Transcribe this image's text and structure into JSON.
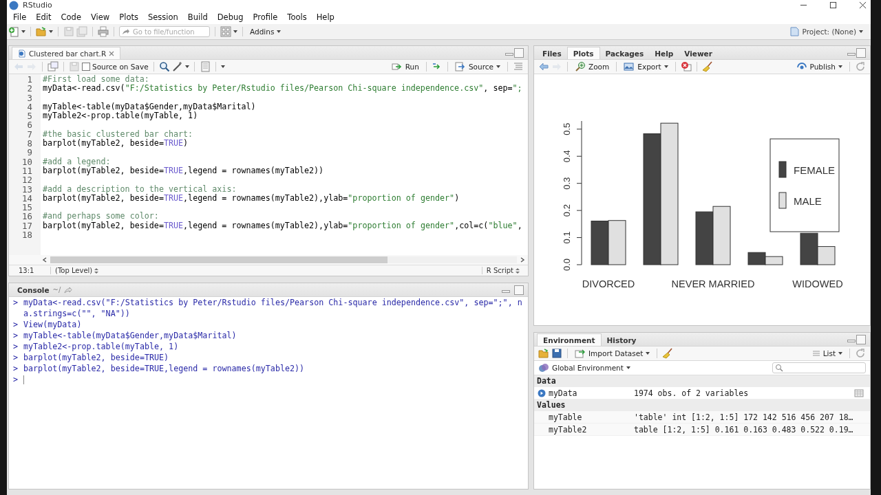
{
  "window": {
    "title": "RStudio"
  },
  "menu": [
    "File",
    "Edit",
    "Code",
    "View",
    "Plots",
    "Session",
    "Build",
    "Debug",
    "Profile",
    "Tools",
    "Help"
  ],
  "toolbar": {
    "goto_placeholder": "Go to file/function",
    "addins": "Addins",
    "project": "Project: (None)"
  },
  "editor": {
    "tab": {
      "label": "Clustered bar chart.R",
      "selected": true
    },
    "source_on_save": {
      "label": "Source on Save",
      "checked": false
    },
    "run": "Run",
    "source": "Source",
    "lines": [
      {
        "number": "1",
        "tokens": [
          {
            "kind": "comment",
            "text": "#First load some data:"
          }
        ]
      },
      {
        "number": "2",
        "tokens": [
          {
            "kind": "code",
            "text": "myData<-read.csv("
          },
          {
            "kind": "string",
            "text": "\"F:/Statistics by Peter/Rstudio files/Pearson Chi-square independence.csv\""
          },
          {
            "kind": "code",
            "text": ", sep="
          },
          {
            "kind": "string",
            "text": "\";"
          }
        ]
      },
      {
        "number": "3"
      },
      {
        "number": "4",
        "tokens": [
          {
            "kind": "code",
            "text": "myTable<-table(myData$Gender,myData$Marital)"
          }
        ]
      },
      {
        "number": "5",
        "tokens": [
          {
            "kind": "code",
            "text": "myTable2<-prop.table(myTable, 1)"
          }
        ]
      },
      {
        "number": "6"
      },
      {
        "number": "7",
        "tokens": [
          {
            "kind": "comment",
            "text": "#the basic clustered bar chart:"
          }
        ]
      },
      {
        "number": "8",
        "tokens": [
          {
            "kind": "code",
            "text": "barplot(myTable2, beside="
          },
          {
            "kind": "keyword",
            "text": "TRUE"
          },
          {
            "kind": "code",
            "text": ")"
          }
        ]
      },
      {
        "number": "9"
      },
      {
        "number": "10",
        "tokens": [
          {
            "kind": "comment",
            "text": "#add a legend:"
          }
        ]
      },
      {
        "number": "11",
        "tokens": [
          {
            "kind": "code",
            "text": "barplot(myTable2, beside="
          },
          {
            "kind": "keyword",
            "text": "TRUE"
          },
          {
            "kind": "code",
            "text": ",legend = rownames(myTable2))"
          }
        ]
      },
      {
        "number": "12"
      },
      {
        "number": "13",
        "tokens": [
          {
            "kind": "comment",
            "text": "#add a description to the vertical axis:"
          }
        ]
      },
      {
        "number": "14",
        "tokens": [
          {
            "kind": "code",
            "text": "barplot(myTable2, beside="
          },
          {
            "kind": "keyword",
            "text": "TRUE"
          },
          {
            "kind": "code",
            "text": ",legend = rownames(myTable2),ylab="
          },
          {
            "kind": "string",
            "text": "\"proportion of gender\""
          },
          {
            "kind": "code",
            "text": ")"
          }
        ]
      },
      {
        "number": "15"
      },
      {
        "number": "16",
        "tokens": [
          {
            "kind": "comment",
            "text": "#and perhaps some color:"
          }
        ]
      },
      {
        "number": "17",
        "tokens": [
          {
            "kind": "code",
            "text": "barplot(myTable2, beside="
          },
          {
            "kind": "keyword",
            "text": "TRUE"
          },
          {
            "kind": "code",
            "text": ",legend = rownames(myTable2),ylab="
          },
          {
            "kind": "string",
            "text": "\"proportion of gender\""
          },
          {
            "kind": "code",
            "text": ",col=c("
          },
          {
            "kind": "string",
            "text": "\"blue\""
          },
          {
            "kind": "code",
            "text": ","
          }
        ]
      },
      {
        "number": "18"
      }
    ],
    "cursor": "13:1",
    "scope": "(Top Level)",
    "file_type": "R Script"
  },
  "console": {
    "title": "Console",
    "path": "~/",
    "lines": [
      {
        "prompt": ">",
        "text": "myData<-read.csv(\"F:/Statistics by Peter/Rstudio files/Pearson Chi-square independence.csv\", sep=\";\", n"
      },
      {
        "text": "a.strings=c(\"\", \"NA\"))"
      },
      {
        "prompt": ">",
        "text": "View(myData)"
      },
      {
        "prompt": ">",
        "text": "myTable<-table(myData$Gender,myData$Marital)"
      },
      {
        "prompt": ">",
        "text": "myTable2<-prop.table(myTable, 1)"
      },
      {
        "prompt": ">",
        "text": "barplot(myTable2, beside=TRUE)"
      },
      {
        "prompt": ">",
        "text": "barplot(myTable2, beside=TRUE,legend = rownames(myTable2))"
      },
      {
        "prompt": ">"
      }
    ]
  },
  "plots_pane": {
    "tabs": [
      {
        "label": "Files",
        "selected": false
      },
      {
        "label": "Plots",
        "selected": true
      },
      {
        "label": "Packages",
        "selected": false
      },
      {
        "label": "Help",
        "selected": false
      },
      {
        "label": "Viewer",
        "selected": false
      }
    ],
    "zoom": "Zoom",
    "export": "Export",
    "publish": "Publish",
    "chart_data": {
      "type": "bar",
      "categories": [
        "DIVORCED",
        null,
        "NEVER MARRIED",
        null,
        "WIDOWED"
      ],
      "series": [
        {
          "name": "FEMALE",
          "color": "#444444",
          "values": [
            0.161,
            0.483,
            0.195,
            0.045,
            0.116
          ]
        },
        {
          "name": "MALE",
          "color": "#e0e0e0",
          "values": [
            0.163,
            0.522,
            0.215,
            0.03,
            0.067
          ]
        }
      ],
      "legend": true,
      "ylim": [
        0,
        0.53
      ],
      "yticks": [
        {
          "value": 0,
          "label": "0.0"
        },
        {
          "value": 0.1,
          "label": "0.1"
        },
        {
          "value": 0.2,
          "label": "0.2"
        },
        {
          "value": 0.3,
          "label": "0.3"
        },
        {
          "value": 0.4,
          "label": "0.4"
        },
        {
          "value": 0.5,
          "label": "0.5"
        }
      ]
    }
  },
  "environment": {
    "tabs": [
      {
        "label": "Environment",
        "selected": true
      },
      {
        "label": "History",
        "selected": false
      }
    ],
    "import": "Import Dataset",
    "view_mode": "List",
    "scope": "Global Environment",
    "sections": [
      {
        "title": "Data",
        "rows": [
          {
            "kind": "data",
            "name": "myData",
            "value": "1974 obs. of 2 variables"
          }
        ]
      },
      {
        "title": "Values",
        "rows": [
          {
            "kind": "value",
            "name": "myTable",
            "value": "'table' int [1:2, 1:5] 172 142 516 456 207 18…"
          },
          {
            "kind": "value",
            "name": "myTable2",
            "value": "table [1:2, 1:5] 0.161 0.163 0.483 0.522 0.19…"
          }
        ]
      }
    ]
  }
}
